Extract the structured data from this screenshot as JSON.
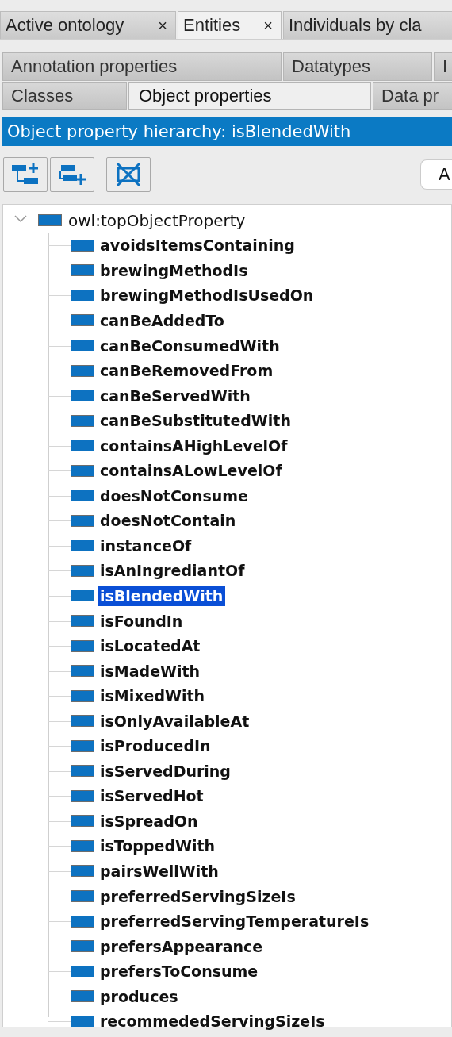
{
  "tabs": [
    {
      "label": "Active ontology",
      "selected": false,
      "close": "×"
    },
    {
      "label": "Entities",
      "selected": true,
      "close": "×"
    },
    {
      "label": "Individuals by cla",
      "selected": false
    }
  ],
  "subtabs": [
    [
      {
        "label": "Annotation properties",
        "selected": false
      },
      {
        "label": "Datatypes",
        "selected": false
      },
      {
        "label": "I",
        "selected": false
      }
    ],
    [
      {
        "label": "Classes",
        "selected": false
      },
      {
        "label": "Object properties",
        "selected": true
      },
      {
        "label": "Data pr",
        "selected": false
      }
    ]
  ],
  "header": {
    "title": "Object property hierarchy: isBlendedWith"
  },
  "toolbar": {
    "side_button": "A"
  },
  "tree": {
    "label": "owl:topObjectProperty",
    "expanded": true,
    "children": [
      {
        "label": "avoidsItemsContaining",
        "selected": false
      },
      {
        "label": "brewingMethodIs",
        "selected": false
      },
      {
        "label": "brewingMethodIsUsedOn",
        "selected": false
      },
      {
        "label": "canBeAddedTo",
        "selected": false
      },
      {
        "label": "canBeConsumedWith",
        "selected": false
      },
      {
        "label": "canBeRemovedFrom",
        "selected": false
      },
      {
        "label": "canBeServedWith",
        "selected": false
      },
      {
        "label": "canBeSubstitutedWith",
        "selected": false
      },
      {
        "label": "containsAHighLevelOf",
        "selected": false
      },
      {
        "label": "containsALowLevelOf",
        "selected": false
      },
      {
        "label": "doesNotConsume",
        "selected": false
      },
      {
        "label": "doesNotContain",
        "selected": false
      },
      {
        "label": "instanceOf",
        "selected": false
      },
      {
        "label": "isAnIngrediantOf",
        "selected": false
      },
      {
        "label": "isBlendedWith",
        "selected": true
      },
      {
        "label": "isFoundIn",
        "selected": false
      },
      {
        "label": "isLocatedAt",
        "selected": false
      },
      {
        "label": "isMadeWith",
        "selected": false
      },
      {
        "label": "isMixedWith",
        "selected": false
      },
      {
        "label": "isOnlyAvailableAt",
        "selected": false
      },
      {
        "label": "isProducedIn",
        "selected": false
      },
      {
        "label": "isServedDuring",
        "selected": false
      },
      {
        "label": "isServedHot",
        "selected": false
      },
      {
        "label": "isSpreadOn",
        "selected": false
      },
      {
        "label": "isToppedWith",
        "selected": false
      },
      {
        "label": "pairsWellWith",
        "selected": false
      },
      {
        "label": "preferredServingSizeIs",
        "selected": false
      },
      {
        "label": "preferredServingTemperatureIs",
        "selected": false
      },
      {
        "label": "prefersAppearance",
        "selected": false
      },
      {
        "label": "prefersToConsume",
        "selected": false
      },
      {
        "label": "produces",
        "selected": false
      },
      {
        "label": "recommededServingSizeIs",
        "selected": false
      }
    ]
  }
}
